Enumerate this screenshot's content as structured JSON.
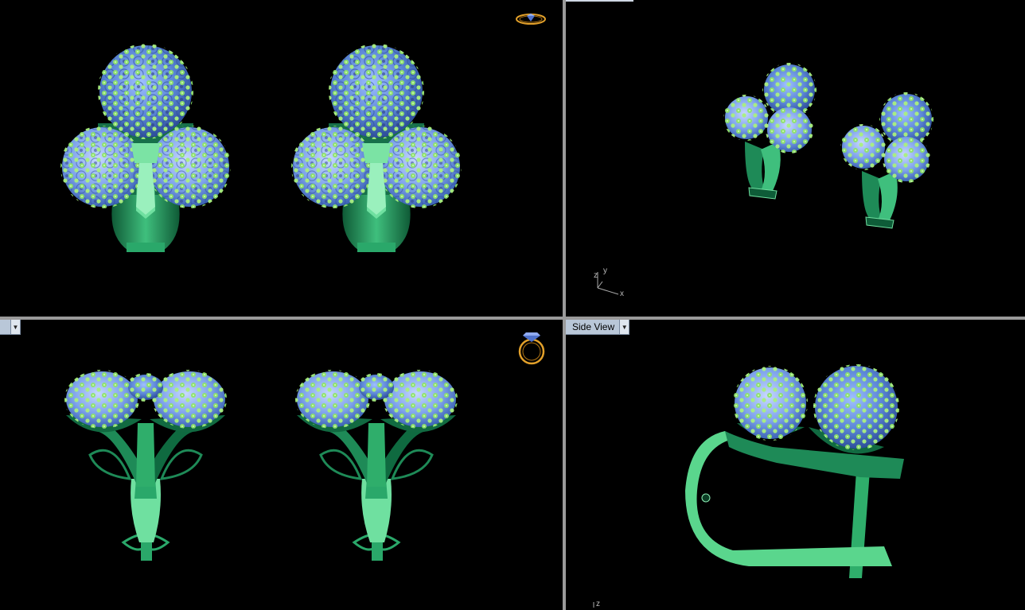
{
  "viewports": {
    "top_left": {
      "name": "front-view"
    },
    "top_right": {
      "name": "perspective-view",
      "axis": {
        "x": "x",
        "y": "y",
        "z": "z"
      }
    },
    "bottom_left": {
      "name": "top-view",
      "label_visible_fragment": ""
    },
    "bottom_right": {
      "label": "Side View",
      "axis": {
        "z": "z"
      }
    }
  },
  "icons": {
    "ring_icon": "ring-icon",
    "gem_icon": "gem-icon",
    "dropdown_icon": "chevron-down-icon"
  },
  "colors": {
    "background": "#000000",
    "metal_green": "#1e8a57",
    "metal_light": "#6fe0a0",
    "stone_blue": "#5b86d6",
    "prong_green": "#8fe36a",
    "divider": "#9a9a9a",
    "label_bg": "#b9c7d8",
    "ring_gold": "#e2a02a"
  }
}
